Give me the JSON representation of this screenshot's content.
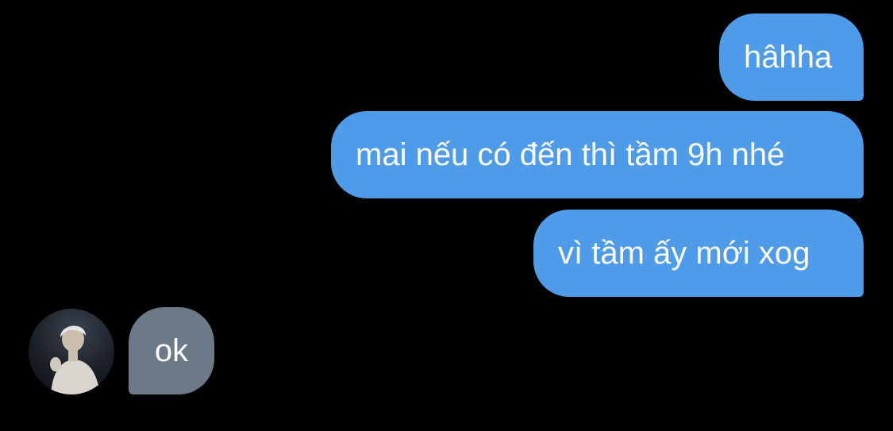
{
  "conversation": {
    "messages": [
      {
        "direction": "outgoing",
        "text": "hâhha"
      },
      {
        "direction": "outgoing",
        "text": "mai nếu có đến thì tầm 9h nhé"
      },
      {
        "direction": "outgoing",
        "text": "vì tầm ấy mới xog"
      },
      {
        "direction": "incoming",
        "text": "ok"
      }
    ],
    "colors": {
      "background": "#000000",
      "outgoing_bubble": "#4e9ce9",
      "incoming_bubble": "#6c7a87",
      "text": "#ffffff"
    }
  }
}
